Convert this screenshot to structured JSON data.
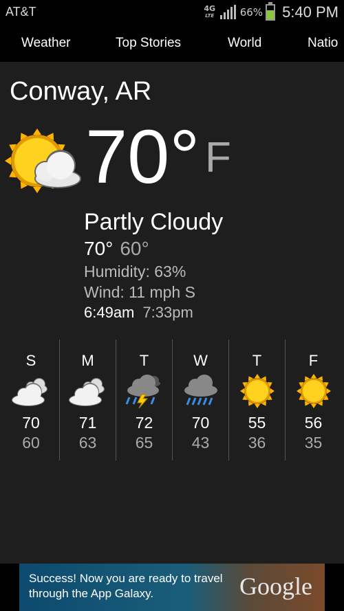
{
  "status_bar": {
    "carrier": "AT&T",
    "network": "4G",
    "network_sub": "LTE",
    "battery": "66%",
    "battery_level": 0.66,
    "time": "5:40 PM",
    "icons": [
      "network-4g-lte-icon",
      "signal-icon",
      "battery-icon"
    ]
  },
  "tabs": [
    {
      "label": "Weather",
      "selected": true
    },
    {
      "label": "Top Stories",
      "selected": false
    },
    {
      "label": "World",
      "selected": false
    },
    {
      "label": "Natio",
      "selected": false
    }
  ],
  "current": {
    "city": "Conway, AR",
    "icon": "partly-cloudy-icon",
    "temp": "70°",
    "unit": "F",
    "condition": "Partly Cloudy",
    "high": "70°",
    "low": "60°",
    "humidity": "Humidity: 63%",
    "wind": "Wind: 11 mph S",
    "sunrise": "6:49am",
    "sunset": "7:33pm"
  },
  "forecast": [
    {
      "day": "S",
      "icon": "cloudy-icon",
      "high": "70",
      "low": "60"
    },
    {
      "day": "M",
      "icon": "cloudy-icon",
      "high": "71",
      "low": "63"
    },
    {
      "day": "T",
      "icon": "thunderstorm-icon",
      "high": "72",
      "low": "65"
    },
    {
      "day": "W",
      "icon": "rain-icon",
      "high": "70",
      "low": "43"
    },
    {
      "day": "T",
      "icon": "sunny-icon",
      "high": "55",
      "low": "36"
    },
    {
      "day": "F",
      "icon": "sunny-icon",
      "high": "56",
      "low": "35"
    }
  ],
  "ad": {
    "text": "Success! Now you are ready to travel through the App Galaxy.",
    "logo": "Google"
  },
  "colors": {
    "accent": "#33b5e5",
    "background": "#1e1e1e",
    "sun": "#ffcc00",
    "rain": "#3a8ee6"
  }
}
